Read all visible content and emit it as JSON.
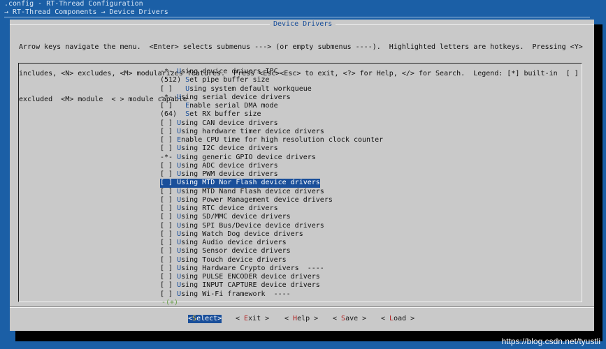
{
  "header": {
    "config_file": ".config - RT-Thread Configuration",
    "breadcrumb": "→ RT-Thread Components → Device Drivers"
  },
  "dialog": {
    "title": "Device Drivers",
    "help_lines": [
      "Arrow keys navigate the menu.  <Enter> selects submenus ---> (or empty submenus ----).  Highlighted letters are hotkeys.  Pressing <Y>",
      "includes, <N> excludes, <M> modularizes features.  Press <Esc><Esc> to exit, <?> for Help, </> for Search.  Legend: [*] built-in  [ ]",
      "excluded  <M> module  < > module capable"
    ]
  },
  "menu": {
    "items": [
      {
        "prefix": "-*- ",
        "hotkey": "U",
        "rest": "sing device drivers IPC"
      },
      {
        "prefix": "(512) ",
        "hotkey": "S",
        "rest": "et pipe buffer size"
      },
      {
        "prefix": "[ ]   ",
        "hotkey": "U",
        "rest": "sing system default workqueue"
      },
      {
        "prefix": "-*- ",
        "hotkey": "U",
        "rest": "sing serial device drivers"
      },
      {
        "prefix": "[ ]   ",
        "hotkey": "E",
        "rest": "nable serial DMA mode"
      },
      {
        "prefix": "(64)  ",
        "hotkey": "S",
        "rest": "et RX buffer size"
      },
      {
        "prefix": "[ ] ",
        "hotkey": "U",
        "rest": "sing CAN device drivers"
      },
      {
        "prefix": "[ ] ",
        "hotkey": "U",
        "rest": "sing hardware timer device drivers"
      },
      {
        "prefix": "[ ] ",
        "hotkey": "E",
        "rest": "nable CPU time for high resolution clock counter"
      },
      {
        "prefix": "[ ] ",
        "hotkey": "U",
        "rest": "sing I2C device drivers"
      },
      {
        "prefix": "-*- ",
        "hotkey": "U",
        "rest": "sing generic GPIO device drivers"
      },
      {
        "prefix": "[ ] ",
        "hotkey": "U",
        "rest": "sing ADC device drivers"
      },
      {
        "prefix": "[ ] ",
        "hotkey": "U",
        "rest": "sing PWM device drivers"
      },
      {
        "prefix": "[ ] ",
        "hotkey": "U",
        "rest": "sing MTD Nor Flash device drivers"
      },
      {
        "prefix": "[ ] ",
        "hotkey": "U",
        "rest": "sing MTD Nand Flash device drivers"
      },
      {
        "prefix": "[ ] ",
        "hotkey": "U",
        "rest": "sing Power Management device drivers"
      },
      {
        "prefix": "[ ] ",
        "hotkey": "U",
        "rest": "sing RTC device drivers"
      },
      {
        "prefix": "[ ] ",
        "hotkey": "U",
        "rest": "sing SD/MMC device drivers"
      },
      {
        "prefix": "[ ] ",
        "hotkey": "U",
        "rest": "sing SPI Bus/Device device drivers"
      },
      {
        "prefix": "[ ] ",
        "hotkey": "U",
        "rest": "sing Watch Dog device drivers"
      },
      {
        "prefix": "[ ] ",
        "hotkey": "U",
        "rest": "sing Audio device drivers"
      },
      {
        "prefix": "[ ] ",
        "hotkey": "U",
        "rest": "sing Sensor device drivers"
      },
      {
        "prefix": "[ ] ",
        "hotkey": "U",
        "rest": "sing Touch device drivers"
      },
      {
        "prefix": "[ ] ",
        "hotkey": "U",
        "rest": "sing Hardware Crypto drivers  ----"
      },
      {
        "prefix": "[ ] ",
        "hotkey": "U",
        "rest": "sing PULSE ENCODER device drivers"
      },
      {
        "prefix": "[ ] ",
        "hotkey": "U",
        "rest": "sing INPUT CAPTURE device drivers"
      },
      {
        "prefix": "[ ] ",
        "hotkey": "U",
        "rest": "sing Wi-Fi framework  ----"
      }
    ],
    "selected_index": 13,
    "more_indicator": "-(+)"
  },
  "buttons": {
    "select": {
      "open": "<",
      "hotkey": "S",
      "rest": "elect",
      "close": ">"
    },
    "exit": {
      "open": "< ",
      "hotkey": "E",
      "rest": "xit",
      "close": " >"
    },
    "help": {
      "open": "< ",
      "hotkey": "H",
      "rest": "elp",
      "close": " >"
    },
    "save": {
      "open": "< ",
      "hotkey": "S",
      "rest": "ave",
      "close": " >"
    },
    "load": {
      "open": "< ",
      "hotkey": "L",
      "rest": "oad",
      "close": " >"
    }
  },
  "watermark": "https://blog.csdn.net/tyustli",
  "colors": {
    "background": "#1b5fa6",
    "dialog": "#c9c9c9",
    "highlight": "#1a4f9a",
    "hotkey": "#1a4f9a",
    "button_hotkey": "#b02020"
  }
}
